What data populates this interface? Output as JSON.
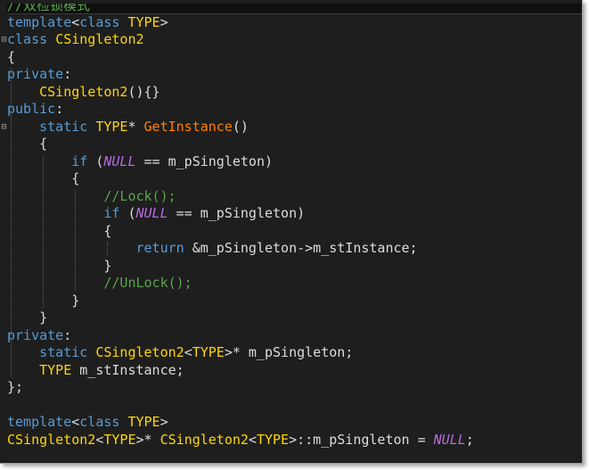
{
  "editor": {
    "lines": [
      [
        {
          "t": "//双检锁模式",
          "c": "cm"
        }
      ],
      [
        {
          "t": "template",
          "c": "kw"
        },
        {
          "t": "<",
          "c": "op"
        },
        {
          "t": "class",
          "c": "kw"
        },
        {
          "t": " ",
          "c": "op"
        },
        {
          "t": "TYPE",
          "c": "ty"
        },
        {
          "t": ">",
          "c": "op"
        }
      ],
      [
        {
          "t": "class",
          "c": "kw"
        },
        {
          "t": " ",
          "c": "op"
        },
        {
          "t": "CSingleton2",
          "c": "ty"
        }
      ],
      [
        {
          "t": "{",
          "c": "op"
        }
      ],
      [
        {
          "t": "private",
          "c": "kw"
        },
        {
          "t": ":",
          "c": "op"
        }
      ],
      [
        {
          "t": "    ",
          "c": "op"
        },
        {
          "t": "CSingleton2",
          "c": "ty"
        },
        {
          "t": "(){}",
          "c": "op"
        }
      ],
      [
        {
          "t": "public",
          "c": "kw"
        },
        {
          "t": ":",
          "c": "op"
        }
      ],
      [
        {
          "t": "    ",
          "c": "op"
        },
        {
          "t": "static",
          "c": "kw"
        },
        {
          "t": " ",
          "c": "op"
        },
        {
          "t": "TYPE",
          "c": "ty"
        },
        {
          "t": "* ",
          "c": "op"
        },
        {
          "t": "GetInstance",
          "c": "fn"
        },
        {
          "t": "()",
          "c": "op"
        }
      ],
      [
        {
          "t": "    {",
          "c": "op"
        }
      ],
      [
        {
          "t": "        ",
          "c": "op"
        },
        {
          "t": "if",
          "c": "kw"
        },
        {
          "t": " (",
          "c": "op"
        },
        {
          "t": "NULL",
          "c": "nl"
        },
        {
          "t": " == m_pSingleton)",
          "c": "op"
        }
      ],
      [
        {
          "t": "        {",
          "c": "op"
        }
      ],
      [
        {
          "t": "            ",
          "c": "op"
        },
        {
          "t": "//Lock();",
          "c": "cm"
        }
      ],
      [
        {
          "t": "            ",
          "c": "op"
        },
        {
          "t": "if",
          "c": "kw"
        },
        {
          "t": " (",
          "c": "op"
        },
        {
          "t": "NULL",
          "c": "nl"
        },
        {
          "t": " == m_pSingleton)",
          "c": "op"
        }
      ],
      [
        {
          "t": "            {",
          "c": "op"
        }
      ],
      [
        {
          "t": "                ",
          "c": "op"
        },
        {
          "t": "return",
          "c": "kw"
        },
        {
          "t": " &m_pSingleton->m_stInstance;",
          "c": "op"
        }
      ],
      [
        {
          "t": "            }",
          "c": "op"
        }
      ],
      [
        {
          "t": "            ",
          "c": "op"
        },
        {
          "t": "//UnLock();",
          "c": "cm"
        }
      ],
      [
        {
          "t": "        }",
          "c": "op"
        }
      ],
      [
        {
          "t": "    }",
          "c": "op"
        }
      ],
      [
        {
          "t": "private",
          "c": "kw"
        },
        {
          "t": ":",
          "c": "op"
        }
      ],
      [
        {
          "t": "    ",
          "c": "op"
        },
        {
          "t": "static",
          "c": "kw"
        },
        {
          "t": " ",
          "c": "op"
        },
        {
          "t": "CSingleton2",
          "c": "ty"
        },
        {
          "t": "<",
          "c": "op"
        },
        {
          "t": "TYPE",
          "c": "ty"
        },
        {
          "t": ">* m_pSingleton;",
          "c": "op"
        }
      ],
      [
        {
          "t": "    ",
          "c": "op"
        },
        {
          "t": "TYPE",
          "c": "ty"
        },
        {
          "t": " m_stInstance;",
          "c": "op"
        }
      ],
      [
        {
          "t": "};",
          "c": "op"
        }
      ],
      [
        {
          "t": "",
          "c": "op"
        }
      ],
      [
        {
          "t": "template",
          "c": "kw"
        },
        {
          "t": "<",
          "c": "op"
        },
        {
          "t": "class",
          "c": "kw"
        },
        {
          "t": " ",
          "c": "op"
        },
        {
          "t": "TYPE",
          "c": "ty"
        },
        {
          "t": ">",
          "c": "op"
        }
      ],
      [
        {
          "t": "CSingleton2",
          "c": "ty"
        },
        {
          "t": "<",
          "c": "op"
        },
        {
          "t": "TYPE",
          "c": "ty"
        },
        {
          "t": ">* ",
          "c": "op"
        },
        {
          "t": "CSingleton2",
          "c": "ty"
        },
        {
          "t": "<",
          "c": "op"
        },
        {
          "t": "TYPE",
          "c": "ty"
        },
        {
          "t": ">::m_pSingleton = ",
          "c": "op"
        },
        {
          "t": "NULL",
          "c": "nl"
        },
        {
          "t": ";",
          "c": "op"
        }
      ]
    ],
    "fold_markers": [
      "minus-icon",
      "minus-icon",
      "minus-icon"
    ]
  }
}
